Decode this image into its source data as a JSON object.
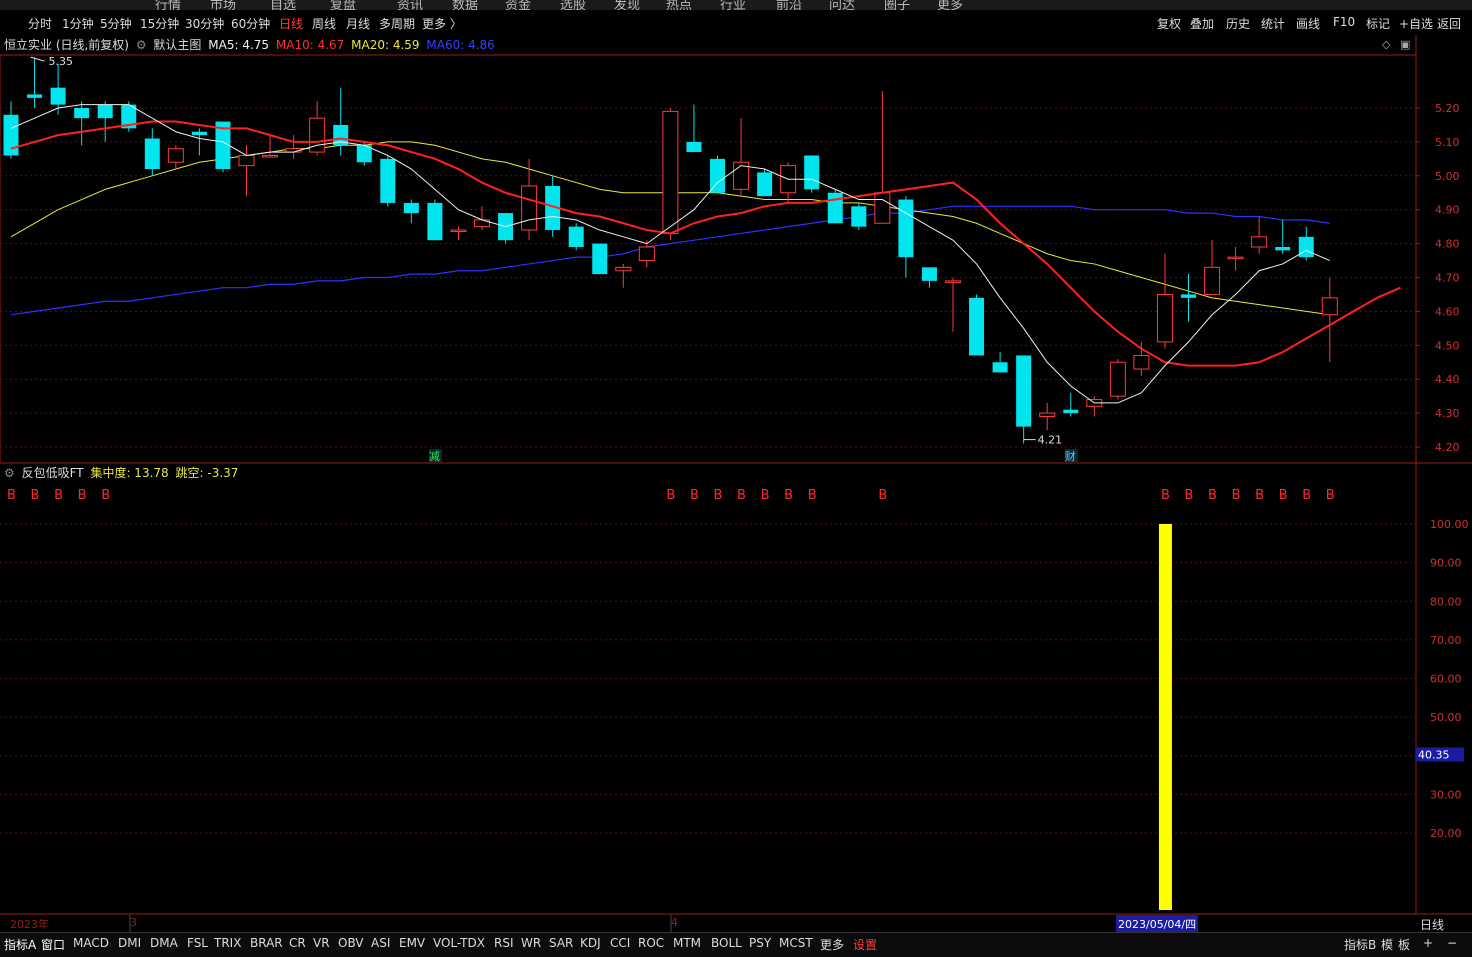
{
  "top_menu": [
    "行情",
    "市场",
    "自选",
    "复盘",
    "资讯",
    "数据",
    "资金",
    "选股",
    "发现",
    "热点",
    "行业",
    "前沿",
    "问达",
    "圈子",
    "更多"
  ],
  "period_tabs": [
    {
      "label": "分时",
      "active": false
    },
    {
      "label": "1分钟",
      "active": false
    },
    {
      "label": "5分钟",
      "active": false
    },
    {
      "label": "15分钟",
      "active": false
    },
    {
      "label": "30分钟",
      "active": false
    },
    {
      "label": "60分钟",
      "active": false
    },
    {
      "label": "日线",
      "active": true
    },
    {
      "label": "周线",
      "active": false
    },
    {
      "label": "月线",
      "active": false
    },
    {
      "label": "多周期",
      "active": false
    },
    {
      "label": "更多 〉",
      "active": false
    }
  ],
  "right_tools": [
    "复权",
    "叠加",
    "历史",
    "统计",
    "画线",
    "F10",
    "标记",
    "+自选",
    "返回"
  ],
  "main_legend": {
    "title": "恒立实业 (日线,前复权)",
    "template": "默认主图",
    "ma5": "MA5: 4.75",
    "ma10": "MA10: 4.67",
    "ma20": "MA20: 4.59",
    "ma60": "MA60: 4.86"
  },
  "colors": {
    "up": "#ff3b3b",
    "down": "#00e5ee",
    "ma5": "#f0f0f0",
    "ma10": "#ff2020",
    "ma20": "#e8e840",
    "ma60": "#3030ff",
    "bar": "#ffff00",
    "axis": "#9b1c1c"
  },
  "main_chart": {
    "price_ticks": [
      "5.20",
      "5.10",
      "5.00",
      "4.90",
      "4.80",
      "4.70",
      "4.60",
      "4.50",
      "4.40",
      "4.30",
      "4.20"
    ],
    "high_label": "5.35",
    "low_label": "4.21",
    "event_markers": [
      {
        "bar": 18,
        "label": "减"
      },
      {
        "bar": 45,
        "label": "财"
      }
    ]
  },
  "indicator": {
    "name": "反包低吸FT",
    "jzd": "集中度: 13.78",
    "tk": "跳空: -3.37",
    "marker_label": "B",
    "ticks": [
      "100.00",
      "90.00",
      "80.00",
      "70.00",
      "60.00",
      "50.00",
      "40.00",
      "30.00",
      "20.00"
    ],
    "current_value": "40.35",
    "bar_value": 100
  },
  "chart_data": {
    "type": "candlestick",
    "bars": [
      {
        "o": 5.18,
        "h": 5.22,
        "l": 5.05,
        "c": 5.06
      },
      {
        "o": 5.24,
        "h": 5.35,
        "l": 5.2,
        "c": 5.23
      },
      {
        "o": 5.26,
        "h": 5.33,
        "l": 5.18,
        "c": 5.21
      },
      {
        "o": 5.2,
        "h": 5.22,
        "l": 5.09,
        "c": 5.17
      },
      {
        "o": 5.21,
        "h": 5.22,
        "l": 5.1,
        "c": 5.17
      },
      {
        "o": 5.21,
        "h": 5.22,
        "l": 5.13,
        "c": 5.14
      },
      {
        "o": 5.11,
        "h": 5.14,
        "l": 5,
        "c": 5.02
      },
      {
        "o": 5.04,
        "h": 5.09,
        "l": 5.02,
        "c": 5.08
      },
      {
        "o": 5.13,
        "h": 5.14,
        "l": 5.06,
        "c": 5.12
      },
      {
        "o": 5.16,
        "h": 5.16,
        "l": 5.01,
        "c": 5.02
      },
      {
        "o": 5.03,
        "h": 5.09,
        "l": 4.94,
        "c": 5.06
      },
      {
        "o": 5.06,
        "h": 5.12,
        "l": 5.06,
        "c": 5.06
      },
      {
        "o": 5.07,
        "h": 5.12,
        "l": 5.05,
        "c": 5.08
      },
      {
        "o": 5.07,
        "h": 5.22,
        "l": 5.06,
        "c": 5.17
      },
      {
        "o": 5.15,
        "h": 5.26,
        "l": 5.06,
        "c": 5.09
      },
      {
        "o": 5.09,
        "h": 5.1,
        "l": 5.03,
        "c": 5.04
      },
      {
        "o": 5.05,
        "h": 5.06,
        "l": 4.91,
        "c": 4.92
      },
      {
        "o": 4.92,
        "h": 4.93,
        "l": 4.86,
        "c": 4.89
      },
      {
        "o": 4.92,
        "h": 4.93,
        "l": 4.81,
        "c": 4.81
      },
      {
        "o": 4.84,
        "h": 4.85,
        "l": 4.81,
        "c": 4.84
      },
      {
        "o": 4.85,
        "h": 4.91,
        "l": 4.84,
        "c": 4.87
      },
      {
        "o": 4.89,
        "h": 4.89,
        "l": 4.8,
        "c": 4.81
      },
      {
        "o": 4.84,
        "h": 5.05,
        "l": 4.81,
        "c": 4.97
      },
      {
        "o": 4.97,
        "h": 5,
        "l": 4.82,
        "c": 4.84
      },
      {
        "o": 4.85,
        "h": 4.86,
        "l": 4.78,
        "c": 4.79
      },
      {
        "o": 4.8,
        "h": 4.8,
        "l": 4.71,
        "c": 4.71
      },
      {
        "o": 4.72,
        "h": 4.74,
        "l": 4.67,
        "c": 4.73
      },
      {
        "o": 4.75,
        "h": 4.81,
        "l": 4.73,
        "c": 4.79
      },
      {
        "o": 4.83,
        "h": 5.2,
        "l": 4.81,
        "c": 5.19
      },
      {
        "o": 5.1,
        "h": 5.21,
        "l": 5.07,
        "c": 5.07
      },
      {
        "o": 5.05,
        "h": 5.06,
        "l": 4.95,
        "c": 4.95
      },
      {
        "o": 4.96,
        "h": 5.17,
        "l": 4.94,
        "c": 5.04
      },
      {
        "o": 5.01,
        "h": 5.02,
        "l": 4.94,
        "c": 4.94
      },
      {
        "o": 4.95,
        "h": 5.04,
        "l": 4.92,
        "c": 5.03
      },
      {
        "o": 5.06,
        "h": 5.06,
        "l": 4.95,
        "c": 4.96
      },
      {
        "o": 4.95,
        "h": 4.96,
        "l": 4.86,
        "c": 4.86
      },
      {
        "o": 4.91,
        "h": 4.92,
        "l": 4.84,
        "c": 4.85
      },
      {
        "o": 4.86,
        "h": 5.25,
        "l": 4.86,
        "c": 4.95
      },
      {
        "o": 4.93,
        "h": 4.94,
        "l": 4.7,
        "c": 4.76
      },
      {
        "o": 4.73,
        "h": 4.73,
        "l": 4.67,
        "c": 4.69
      },
      {
        "o": 4.69,
        "h": 4.7,
        "l": 4.54,
        "c": 4.69
      },
      {
        "o": 4.64,
        "h": 4.65,
        "l": 4.47,
        "c": 4.47
      },
      {
        "o": 4.45,
        "h": 4.48,
        "l": 4.42,
        "c": 4.42
      },
      {
        "o": 4.47,
        "h": 4.47,
        "l": 4.21,
        "c": 4.26
      },
      {
        "o": 4.29,
        "h": 4.33,
        "l": 4.25,
        "c": 4.3
      },
      {
        "o": 4.31,
        "h": 4.36,
        "l": 4.29,
        "c": 4.3
      },
      {
        "o": 4.32,
        "h": 4.35,
        "l": 4.29,
        "c": 4.34
      },
      {
        "o": 4.35,
        "h": 4.46,
        "l": 4.34,
        "c": 4.45
      },
      {
        "o": 4.43,
        "h": 4.51,
        "l": 4.41,
        "c": 4.47
      },
      {
        "o": 4.51,
        "h": 4.77,
        "l": 4.49,
        "c": 4.65
      },
      {
        "o": 4.65,
        "h": 4.71,
        "l": 4.57,
        "c": 4.64
      },
      {
        "o": 4.65,
        "h": 4.81,
        "l": 4.65,
        "c": 4.73
      },
      {
        "o": 4.76,
        "h": 4.79,
        "l": 4.72,
        "c": 4.76
      },
      {
        "o": 4.79,
        "h": 4.88,
        "l": 4.77,
        "c": 4.82
      },
      {
        "o": 4.79,
        "h": 4.87,
        "l": 4.77,
        "c": 4.78
      },
      {
        "o": 4.82,
        "h": 4.85,
        "l": 4.75,
        "c": 4.76
      },
      {
        "o": 4.59,
        "h": 4.7,
        "l": 4.45,
        "c": 4.64
      }
    ],
    "ma5": [
      5.14,
      5.17,
      5.2,
      5.21,
      5.21,
      5.21,
      5.17,
      5.13,
      5.11,
      5.1,
      5.06,
      5.07,
      5.07,
      5.09,
      5.1,
      5.09,
      5.06,
      5.02,
      4.96,
      4.9,
      4.87,
      4.85,
      4.87,
      4.88,
      4.87,
      4.84,
      4.82,
      4.8,
      4.85,
      4.9,
      4.98,
      5.03,
      5.02,
      4.99,
      4.99,
      4.96,
      4.93,
      4.93,
      4.89,
      4.85,
      4.81,
      4.74,
      4.64,
      4.55,
      4.45,
      4.38,
      4.33,
      4.33,
      4.36,
      4.44,
      4.51,
      4.59,
      4.65,
      4.72,
      4.74,
      4.78,
      4.75
    ],
    "ma10": [
      5.08,
      5.1,
      5.12,
      5.13,
      5.14,
      5.15,
      5.16,
      5.16,
      5.15,
      5.14,
      5.14,
      5.12,
      5.1,
      5.1,
      5.11,
      5.1,
      5.09,
      5.07,
      5.05,
      5.02,
      4.98,
      4.95,
      4.93,
      4.91,
      4.89,
      4.88,
      4.86,
      4.84,
      4.83,
      4.86,
      4.88,
      4.89,
      4.91,
      4.92,
      4.92,
      4.93,
      4.94,
      4.95,
      4.96,
      4.97,
      4.98,
      4.93,
      4.86,
      4.8,
      4.74,
      4.67,
      4.6,
      4.54,
      4.49,
      4.45,
      4.44,
      4.44,
      4.44,
      4.45,
      4.48,
      4.52,
      4.56,
      4.6,
      4.64,
      4.67
    ],
    "ma20": [
      4.82,
      4.86,
      4.9,
      4.93,
      4.96,
      4.98,
      5.0,
      5.02,
      5.04,
      5.05,
      5.06,
      5.07,
      5.08,
      5.08,
      5.09,
      5.09,
      5.1,
      5.1,
      5.09,
      5.07,
      5.05,
      5.04,
      5.02,
      5.0,
      4.98,
      4.96,
      4.95,
      4.95,
      4.95,
      4.95,
      4.95,
      4.94,
      4.93,
      4.93,
      4.93,
      4.92,
      4.92,
      4.91,
      4.9,
      4.89,
      4.88,
      4.86,
      4.83,
      4.8,
      4.77,
      4.75,
      4.74,
      4.72,
      4.7,
      4.68,
      4.66,
      4.64,
      4.63,
      4.62,
      4.61,
      4.6,
      4.59
    ],
    "ma60": [
      4.59,
      4.6,
      4.61,
      4.62,
      4.63,
      4.63,
      4.64,
      4.65,
      4.66,
      4.67,
      4.67,
      4.68,
      4.68,
      4.69,
      4.69,
      4.7,
      4.7,
      4.71,
      4.71,
      4.72,
      4.72,
      4.73,
      4.74,
      4.75,
      4.76,
      4.76,
      4.77,
      4.79,
      4.8,
      4.81,
      4.82,
      4.83,
      4.84,
      4.85,
      4.86,
      4.87,
      4.88,
      4.89,
      4.89,
      4.9,
      4.91,
      4.91,
      4.91,
      4.91,
      4.91,
      4.91,
      4.9,
      4.9,
      4.9,
      4.9,
      4.89,
      4.89,
      4.88,
      4.88,
      4.87,
      4.87,
      4.86
    ],
    "b_bars": [
      0,
      1,
      2,
      3,
      4,
      28,
      29,
      30,
      31,
      32,
      33,
      34,
      37,
      49,
      50,
      51,
      52,
      53,
      54,
      55,
      56
    ],
    "ylim": [
      4.18,
      5.4
    ]
  },
  "date_axis": {
    "year": "2023年",
    "m3": "3",
    "m4": "4",
    "cursor_date": "2023/05/04/四",
    "right_label": "日线"
  },
  "bottom_tabs": [
    "指标A",
    "窗口",
    "MACD",
    "DMI",
    "DMA",
    "FSL",
    "TRIX",
    "BRAR",
    "CR",
    "VR",
    "OBV",
    "ASI",
    "EMV",
    "VOL-TDX",
    "RSI",
    "WR",
    "SAR",
    "KDJ",
    "CCI",
    "ROC",
    "MTM",
    "BOLL",
    "PSY",
    "MCST",
    "更多",
    "设置"
  ],
  "bottom_right": [
    "指标B",
    "模",
    "板",
    "+",
    "−"
  ]
}
